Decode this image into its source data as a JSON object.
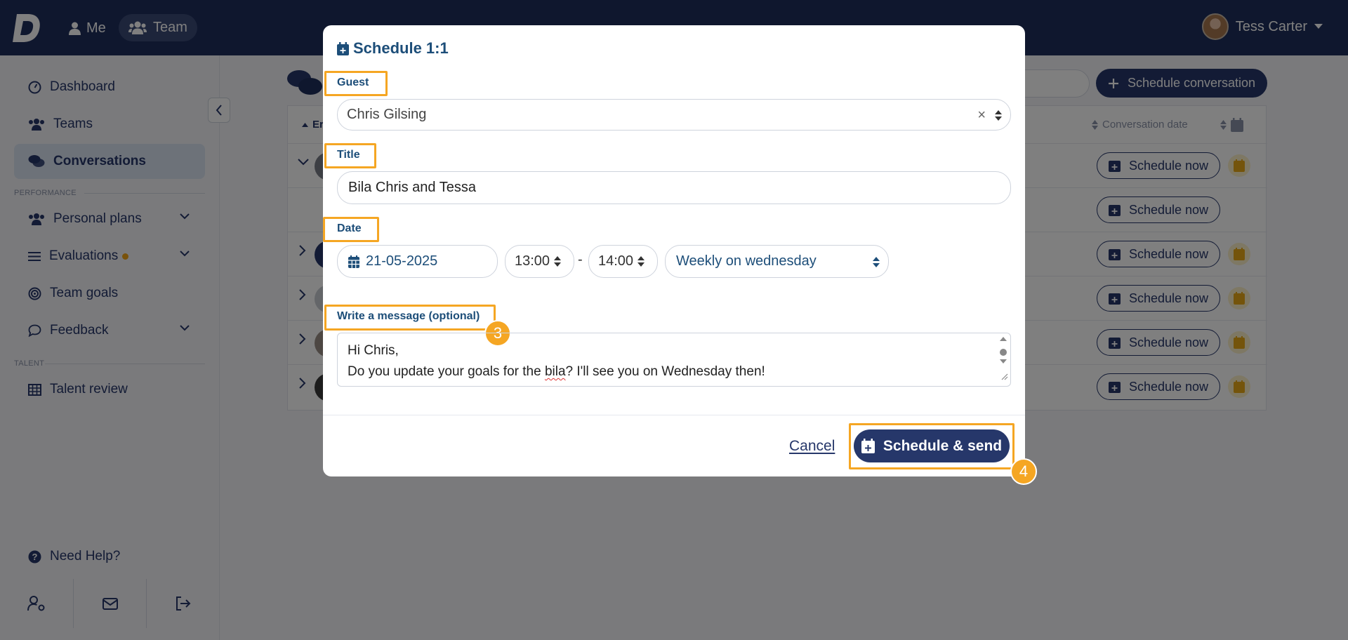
{
  "header": {
    "nav_me": "Me",
    "nav_team": "Team",
    "user_name": "Tess Carter"
  },
  "sidebar": {
    "items": [
      {
        "label": "Dashboard"
      },
      {
        "label": "Teams"
      },
      {
        "label": "Conversations"
      },
      {
        "label": "Personal plans"
      },
      {
        "label": "Evaluations"
      },
      {
        "label": "Team goals"
      },
      {
        "label": "Feedback"
      },
      {
        "label": "Talent review"
      },
      {
        "label": "Need Help?"
      }
    ],
    "section_performance": "PERFORMANCE",
    "section_talent": "TALENT"
  },
  "main": {
    "schedule_conversation": "Schedule conversation",
    "col_first": "Er",
    "col_date": "Conversation date",
    "row_action": "Schedule now"
  },
  "modal": {
    "title": "Schedule 1:1",
    "guest_label": "Guest",
    "guest_value": "Chris Gilsing",
    "title_label": "Title",
    "title_value": "Bila Chris and Tessa",
    "date_label": "Date",
    "date_value": "21-05-2025",
    "start_time": "13:00",
    "time_separator": "-",
    "end_time": "14:00",
    "recurrence": "Weekly on wednesday",
    "message_label": "Write a message (optional)",
    "message_line1": "Hi Chris,",
    "message_line2_before": "Do you update your goals for the ",
    "message_line2_word": "bila",
    "message_line2_after": "? I'll see you on Wednesday then!",
    "cancel": "Cancel",
    "submit": "Schedule & send"
  },
  "annotations": {
    "step3": "3",
    "step4": "4",
    "highlight_color": "#f5a623"
  },
  "colors": {
    "brand_navy": "#1e2e5c",
    "primary_button": "#26376a",
    "label_blue": "#1d4e79"
  }
}
